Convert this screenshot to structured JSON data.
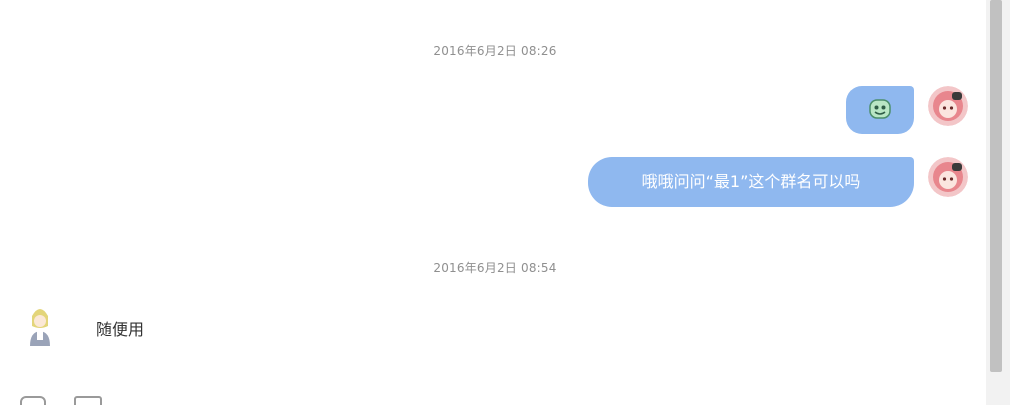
{
  "chat": {
    "messages": [
      {
        "timestamp": "2016年6月2日 08:26",
        "items": [
          {
            "side": "right",
            "type": "sticker",
            "sticker_icon": "smiley-sticker-icon",
            "avatar_icon": "cartoon-avatar-icon"
          },
          {
            "side": "right",
            "type": "text",
            "text": "哦哦问问“最1”这个群名可以吗",
            "avatar_icon": "cartoon-avatar-icon"
          }
        ]
      },
      {
        "timestamp": "2016年6月2日 08:54",
        "items": [
          {
            "side": "left",
            "type": "text",
            "text": "随便用",
            "avatar_icon": "character-avatar-icon"
          }
        ]
      }
    ]
  },
  "toolbar": {
    "icons": [
      "emoji-icon",
      "image-icon"
    ]
  },
  "colors": {
    "bubble_blue": "#8fb8ef",
    "timestamp_gray": "#8f8f8f",
    "scrollbar_thumb": "#c1c1c1"
  }
}
